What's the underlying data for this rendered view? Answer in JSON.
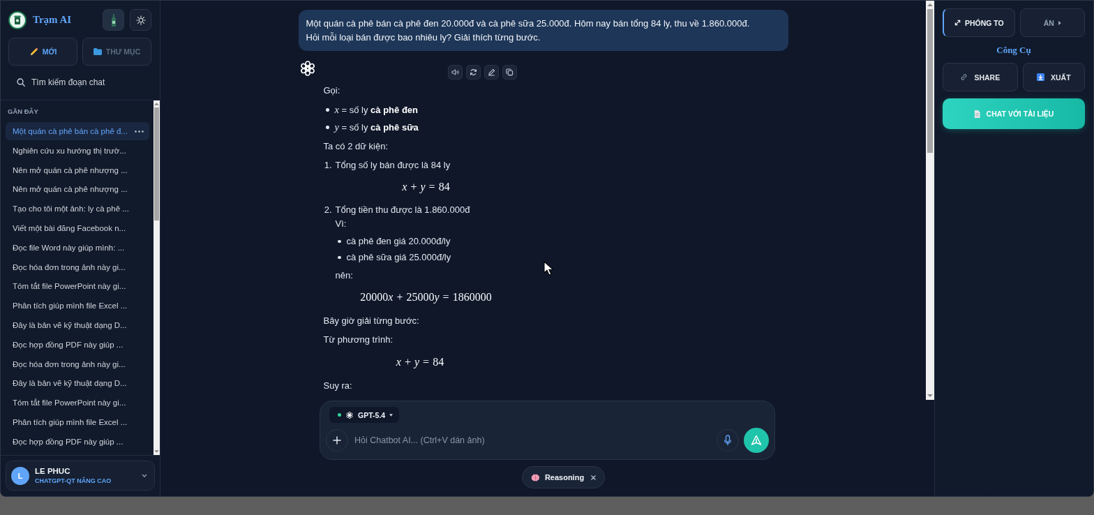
{
  "sidebar": {
    "brand": "Trạm AI",
    "buttons": [
      {
        "kind": "new",
        "label": "MỚI"
      },
      {
        "kind": "folder",
        "label": "THƯ MỤC"
      }
    ],
    "search": {
      "placeholder": "Tìm kiếm đoạn chat"
    },
    "section_title": "GẦN ĐÂY",
    "chats": [
      {
        "title": "Một quán cà phê bán cà phê đ...",
        "selected": true
      },
      {
        "title": "Nghiên cứu xu hướng thị trườ...",
        "selected": false
      },
      {
        "title": "Nên mở quán cà phê nhượng ...",
        "selected": false
      },
      {
        "title": "Nên mở quán cà phê nhượng ...",
        "selected": false
      },
      {
        "title": "Tạo cho tôi một ảnh: ly cà phê ...",
        "selected": false
      },
      {
        "title": "Viết một bài đăng Facebook n...",
        "selected": false
      },
      {
        "title": "Đọc file Word này giúp mình: ...",
        "selected": false
      },
      {
        "title": "Đọc hóa đơn trong ảnh này gi...",
        "selected": false
      },
      {
        "title": "Tóm tắt file PowerPoint này gi...",
        "selected": false
      },
      {
        "title": "Phân tích giúp mình file Excel ...",
        "selected": false
      },
      {
        "title": "Đây là bản vẽ kỹ thuật dạng D...",
        "selected": false
      },
      {
        "title": "Đọc hợp đồng PDF này giúp ...",
        "selected": false
      },
      {
        "title": "Đọc hóa đơn trong ảnh này gi...",
        "selected": false
      },
      {
        "title": "Đây là bản vẽ kỹ thuật dạng D...",
        "selected": false
      },
      {
        "title": "Tóm tắt file PowerPoint này gi...",
        "selected": false
      },
      {
        "title": "Phân tích giúp mình file Excel ...",
        "selected": false
      },
      {
        "title": "Đọc hợp đồng PDF này giúp ...",
        "selected": false
      }
    ],
    "user": {
      "initial": "L",
      "name": "LE PHUC",
      "plan": "CHATGPT-QT NÂNG CAO"
    }
  },
  "conversation": {
    "user_message": "Một quán cà phê bán cà phê đen 20.000đ và cà phê sữa 25.000đ. Hôm nay bán tổng 84 ly, thu về 1.860.000đ.\nHỏi mỗi loại bán được bao nhiêu ly? Giải thích từng bước.",
    "answer": [
      {
        "kind": "paragraph",
        "text": "Gọi:"
      },
      {
        "kind": "bullets",
        "items": [
          "*x* = số ly **cà phê đen**",
          "*y* = số ly **cà phê sữa**"
        ]
      },
      {
        "kind": "paragraph",
        "text": "Ta có 2 dữ kiện:"
      },
      {
        "kind": "numbered",
        "items": [
          {
            "number": "1.",
            "text": "Tổng số ly bán được là 84 ly",
            "blocks": [
              {
                "kind": "math",
                "text": "x + y = 84"
              }
            ]
          },
          {
            "number": "2.",
            "text": "Tổng tiền thu được là 1.860.000đ",
            "blocks": [
              {
                "kind": "paragraph",
                "text": "Vì:"
              },
              {
                "kind": "bullets",
                "items": [
                  "cà phê đen giá 20.000đ/ly",
                  "cà phê sữa giá 25.000đ/ly"
                ]
              },
              {
                "kind": "paragraph",
                "text": "nên:"
              },
              {
                "kind": "math",
                "text": "20000x + 25000y = 1860000"
              }
            ]
          }
        ]
      },
      {
        "kind": "paragraph",
        "text": "Bây giờ giải từng bước:"
      },
      {
        "kind": "paragraph",
        "text": "Từ phương trình:"
      },
      {
        "kind": "math",
        "text": "x + y = 84"
      },
      {
        "kind": "paragraph",
        "text": "Suy ra:"
      }
    ]
  },
  "composer": {
    "model": {
      "name": "GPT-5.4",
      "online": true
    },
    "placeholder": "Hỏi Chatbot AI... (Ctrl+V dán ảnh)",
    "chip": {
      "label": "Reasoning"
    }
  },
  "right_panel": {
    "view_buttons": [
      {
        "kind": "expand",
        "label": "PHÓNG TO",
        "selected": true
      },
      {
        "kind": "hide",
        "label": "ẨN",
        "selected": false
      }
    ],
    "title": "Công Cụ",
    "tools": [
      {
        "kind": "share",
        "label": "SHARE"
      },
      {
        "kind": "export",
        "label": "XUẤT"
      }
    ],
    "primary_action": "CHAT VỚI TÀI LIỆU"
  }
}
